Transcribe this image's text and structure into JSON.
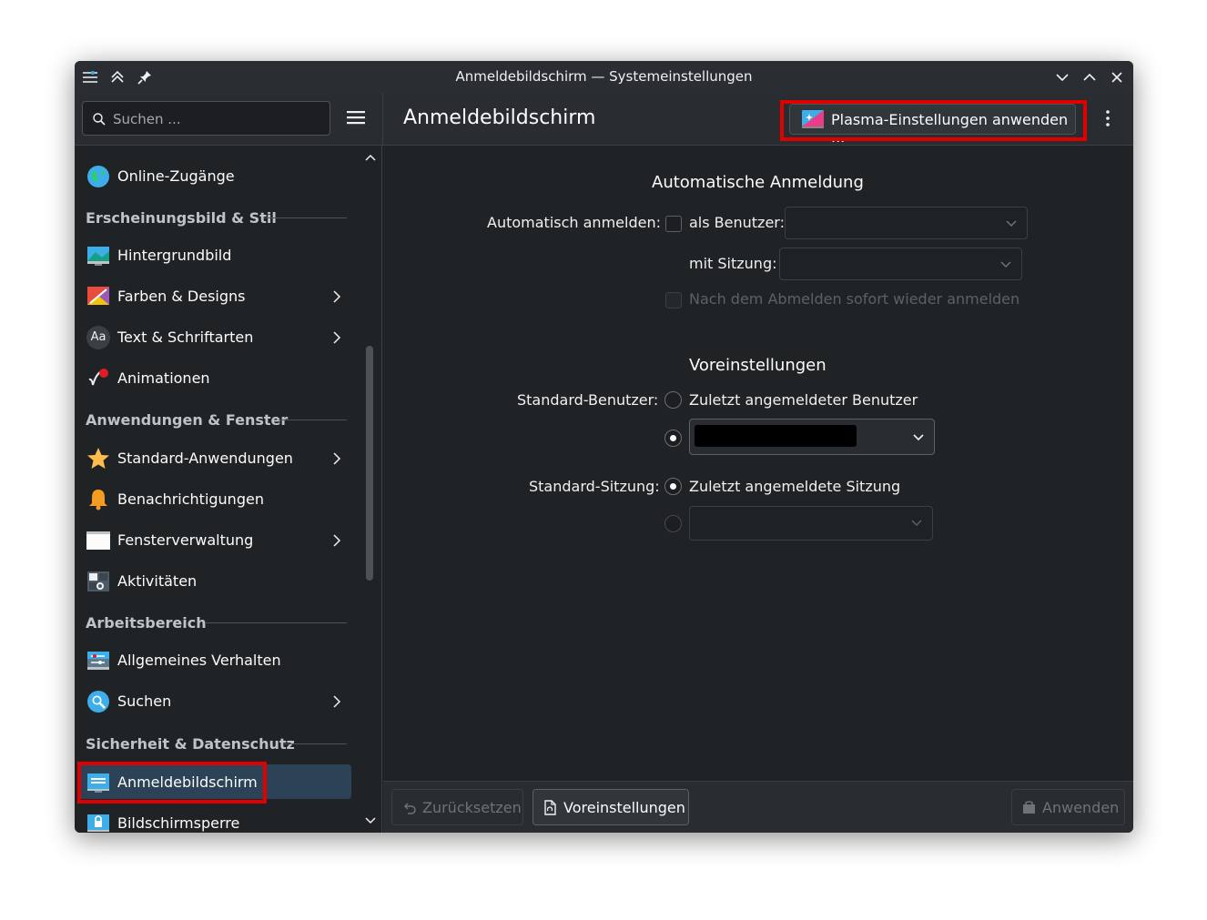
{
  "window": {
    "title": "Anmeldebildschirm — Systemeinstellungen"
  },
  "header": {
    "search_placeholder": "Suchen ...",
    "page_title": "Anmeldebildschirm",
    "plasma_button_label": "Plasma-Einstellungen anwenden ..."
  },
  "sidebar": {
    "items": {
      "online": "Online-Zugänge",
      "wallpaper": "Hintergrundbild",
      "colors": "Farben & Designs",
      "fonts": "Text & Schriftarten",
      "animations": "Animationen",
      "default_apps": "Standard-Anwendungen",
      "notifications": "Benachrichtigungen",
      "window_mgmt": "Fensterverwaltung",
      "activities": "Aktivitäten",
      "general_behavior": "Allgemeines Verhalten",
      "search": "Suchen",
      "login_screen": "Anmeldebildschirm",
      "screen_lock": "Bildschirmsperre"
    },
    "headings": {
      "appearance": "Erscheinungsbild & Stil",
      "apps_windows": "Anwendungen & Fenster",
      "workspace": "Arbeitsbereich",
      "security": "Sicherheit & Datenschutz"
    },
    "fonts_icon_text": "Aa",
    "selected": "Anmeldebildschirm"
  },
  "autologin": {
    "section_title": "Automatische Anmeldung",
    "label": "Automatisch anmelden:",
    "as_user": "als Benutzer:",
    "with_session": "mit Sitzung:",
    "relogin": "Nach dem Abmelden sofort wieder anmelden",
    "enabled": false
  },
  "defaults": {
    "section_title": "Voreinstellungen",
    "user_label": "Standard-Benutzer:",
    "last_user": "Zuletzt angemeldeter Benutzer",
    "user_choice": "specific",
    "session_label": "Standard-Sitzung:",
    "last_session": "Zuletzt angemeldete Sitzung",
    "session_choice": "last"
  },
  "footer": {
    "reset": "Zurücksetzen",
    "defaults": "Voreinstellungen",
    "apply": "Anwenden"
  },
  "colors": {
    "accent_selected": "#2b4257",
    "highlight_box": "#e10000",
    "window_bg": "#202326"
  }
}
